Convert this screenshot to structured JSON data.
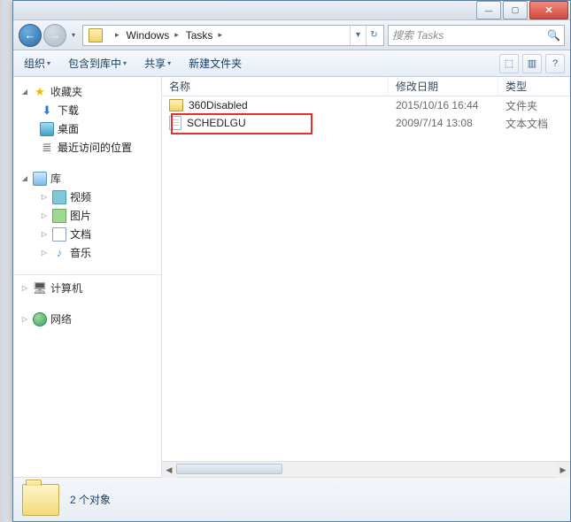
{
  "window_buttons": {
    "min": "—",
    "max": "▢",
    "close": "✕"
  },
  "address": {
    "back": "←",
    "fwd": "→",
    "crumbs": [
      "Windows",
      "Tasks"
    ],
    "sep": "▸",
    "refresh": "↻",
    "dropdown": "▾"
  },
  "search": {
    "placeholder": "搜索 Tasks",
    "icon": "🔍"
  },
  "toolbar": {
    "organize": "组织",
    "include": "包含到库中",
    "share": "共享",
    "newfolder": "新建文件夹",
    "dd": "▾",
    "view_icon": "⬚",
    "preview_icon": "▥",
    "help_icon": "?"
  },
  "sidebar": {
    "favorites": {
      "label": "收藏夹"
    },
    "fav_items": [
      {
        "label": "下载"
      },
      {
        "label": "桌面"
      },
      {
        "label": "最近访问的位置"
      }
    ],
    "libraries": {
      "label": "库"
    },
    "lib_items": [
      {
        "label": "视频"
      },
      {
        "label": "图片"
      },
      {
        "label": "文档"
      },
      {
        "label": "音乐"
      }
    ],
    "computer": {
      "label": "计算机"
    },
    "network": {
      "label": "网络"
    },
    "tri_open": "◢",
    "tri_closed": "▷"
  },
  "columns": {
    "name": "名称",
    "date": "修改日期",
    "type": "类型"
  },
  "rows": [
    {
      "name": "360Disabled",
      "date": "2015/10/16 16:44",
      "type": "文件夹",
      "kind": "folder"
    },
    {
      "name": "SCHEDLGU",
      "date": "2009/7/14 13:08",
      "type": "文本文档",
      "kind": "file"
    }
  ],
  "details": {
    "count_label": "2 个对象"
  }
}
